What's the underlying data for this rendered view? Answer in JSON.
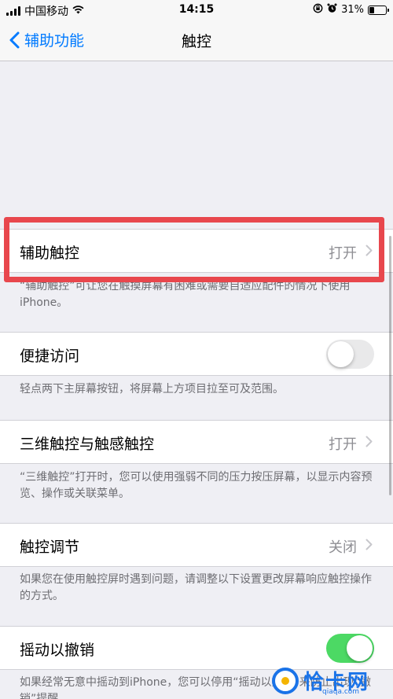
{
  "status_bar": {
    "carrier": "中国移动",
    "time": "14:15",
    "battery_percent": "31%",
    "battery_level": 0.31
  },
  "nav": {
    "back_label": "辅助功能",
    "title": "触控"
  },
  "sections": {
    "assistive_touch": {
      "label": "辅助触控",
      "value": "打开",
      "footer": "“辅助触控”可让您在触摸屏幕有困难或需要自适应配件的情况下使用iPhone。"
    },
    "reachability": {
      "label": "便捷访问",
      "toggle_on": false,
      "footer": "轻点两下主屏幕按钮，将屏幕上方项目拉至可及范围。"
    },
    "touch_3d": {
      "label": "三维触控与触感触控",
      "value": "打开",
      "footer": "“三维触控”打开时，您可以使用强弱不同的压力按压屏幕，以显示内容预览、操作或关联菜单。"
    },
    "touch_accommodations": {
      "label": "触控调节",
      "value": "关闭",
      "footer": "如果您在使用触控屏时遇到问题，请调整以下设置更改屏幕响应触控操作的方式。"
    },
    "shake_to_undo": {
      "label": "摇动以撤销",
      "toggle_on": true,
      "footer": "如果经常无意中摇动到iPhone，您可以停用“摇动以撤销”来防止出现“撤销”提醒。"
    }
  },
  "watermark": {
    "brand": "恰卡网",
    "url": "qiaqa.com"
  },
  "colors": {
    "ios_blue": "#007aff",
    "toggle_green": "#4cd964",
    "highlight_red": "#e8474d"
  }
}
